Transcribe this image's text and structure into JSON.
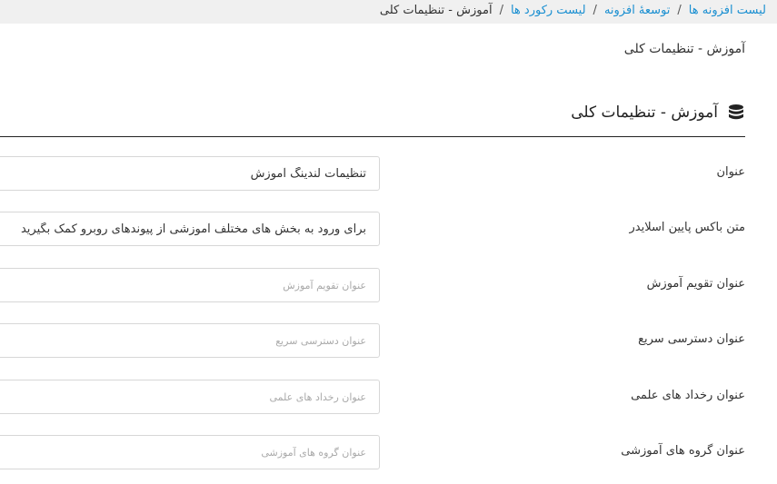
{
  "breadcrumb": {
    "items": [
      "لیست افزونه ها",
      "توسعهٔ افزونه",
      "لیست رکورد ها"
    ],
    "current": "آموزش - تنظیمات کلی",
    "separator": "/"
  },
  "page": {
    "title": "آموزش - تنظیمات کلی"
  },
  "section": {
    "title": "آموزش - تنظیمات کلی",
    "icon": "database-icon"
  },
  "form": {
    "fields": [
      {
        "label": "عنوان",
        "value": "تنظیمات لندینگ آموزش",
        "placeholder": ""
      },
      {
        "label": "متن باکس پایین اسلایدر",
        "value": "برای ورود به بخش های مختلف آموزشی از پیوندهای روبرو کمک بگیرید",
        "placeholder": ""
      },
      {
        "label": "عنوان تقویم آموزش",
        "value": "",
        "placeholder": "عنوان تقویم آموزش"
      },
      {
        "label": "عنوان دسترسی سریع",
        "value": "",
        "placeholder": "عنوان دسترسی سریع"
      },
      {
        "label": "عنوان رخداد های علمی",
        "value": "",
        "placeholder": "عنوان رخداد های علمی"
      },
      {
        "label": "عنوان گروه های آموزشی",
        "value": "",
        "placeholder": "عنوان گروه های آموزشی"
      }
    ]
  },
  "colors": {
    "link": "#1a8fd1",
    "topbar_bg": "#f0f0f0",
    "border": "#d7d7d7"
  }
}
